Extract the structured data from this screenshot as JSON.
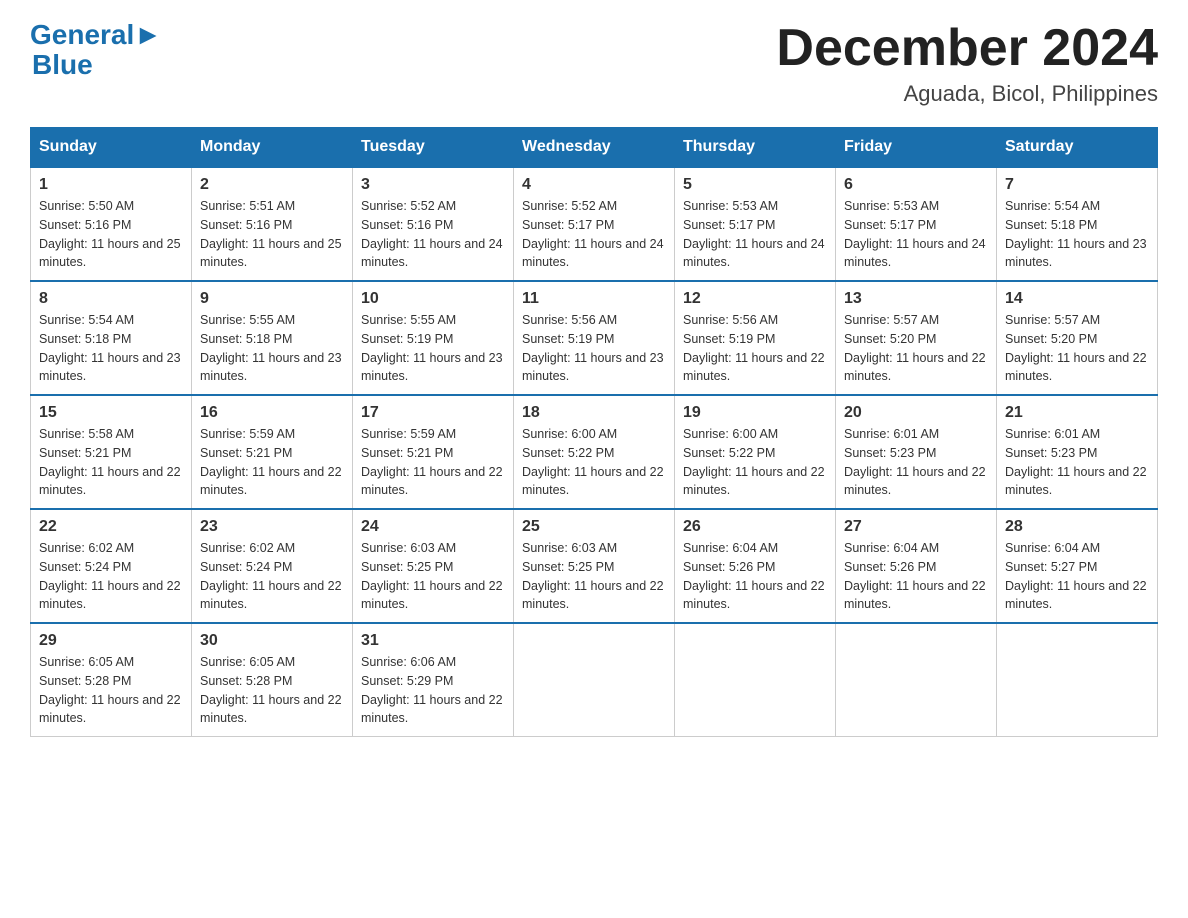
{
  "header": {
    "logo_general": "General",
    "logo_blue": "Blue",
    "month_title": "December 2024",
    "location": "Aguada, Bicol, Philippines"
  },
  "weekdays": [
    "Sunday",
    "Monday",
    "Tuesday",
    "Wednesday",
    "Thursday",
    "Friday",
    "Saturday"
  ],
  "weeks": [
    [
      {
        "day": "1",
        "sunrise": "5:50 AM",
        "sunset": "5:16 PM",
        "daylight": "11 hours and 25 minutes."
      },
      {
        "day": "2",
        "sunrise": "5:51 AM",
        "sunset": "5:16 PM",
        "daylight": "11 hours and 25 minutes."
      },
      {
        "day": "3",
        "sunrise": "5:52 AM",
        "sunset": "5:16 PM",
        "daylight": "11 hours and 24 minutes."
      },
      {
        "day": "4",
        "sunrise": "5:52 AM",
        "sunset": "5:17 PM",
        "daylight": "11 hours and 24 minutes."
      },
      {
        "day": "5",
        "sunrise": "5:53 AM",
        "sunset": "5:17 PM",
        "daylight": "11 hours and 24 minutes."
      },
      {
        "day": "6",
        "sunrise": "5:53 AM",
        "sunset": "5:17 PM",
        "daylight": "11 hours and 24 minutes."
      },
      {
        "day": "7",
        "sunrise": "5:54 AM",
        "sunset": "5:18 PM",
        "daylight": "11 hours and 23 minutes."
      }
    ],
    [
      {
        "day": "8",
        "sunrise": "5:54 AM",
        "sunset": "5:18 PM",
        "daylight": "11 hours and 23 minutes."
      },
      {
        "day": "9",
        "sunrise": "5:55 AM",
        "sunset": "5:18 PM",
        "daylight": "11 hours and 23 minutes."
      },
      {
        "day": "10",
        "sunrise": "5:55 AM",
        "sunset": "5:19 PM",
        "daylight": "11 hours and 23 minutes."
      },
      {
        "day": "11",
        "sunrise": "5:56 AM",
        "sunset": "5:19 PM",
        "daylight": "11 hours and 23 minutes."
      },
      {
        "day": "12",
        "sunrise": "5:56 AM",
        "sunset": "5:19 PM",
        "daylight": "11 hours and 22 minutes."
      },
      {
        "day": "13",
        "sunrise": "5:57 AM",
        "sunset": "5:20 PM",
        "daylight": "11 hours and 22 minutes."
      },
      {
        "day": "14",
        "sunrise": "5:57 AM",
        "sunset": "5:20 PM",
        "daylight": "11 hours and 22 minutes."
      }
    ],
    [
      {
        "day": "15",
        "sunrise": "5:58 AM",
        "sunset": "5:21 PM",
        "daylight": "11 hours and 22 minutes."
      },
      {
        "day": "16",
        "sunrise": "5:59 AM",
        "sunset": "5:21 PM",
        "daylight": "11 hours and 22 minutes."
      },
      {
        "day": "17",
        "sunrise": "5:59 AM",
        "sunset": "5:21 PM",
        "daylight": "11 hours and 22 minutes."
      },
      {
        "day": "18",
        "sunrise": "6:00 AM",
        "sunset": "5:22 PM",
        "daylight": "11 hours and 22 minutes."
      },
      {
        "day": "19",
        "sunrise": "6:00 AM",
        "sunset": "5:22 PM",
        "daylight": "11 hours and 22 minutes."
      },
      {
        "day": "20",
        "sunrise": "6:01 AM",
        "sunset": "5:23 PM",
        "daylight": "11 hours and 22 minutes."
      },
      {
        "day": "21",
        "sunrise": "6:01 AM",
        "sunset": "5:23 PM",
        "daylight": "11 hours and 22 minutes."
      }
    ],
    [
      {
        "day": "22",
        "sunrise": "6:02 AM",
        "sunset": "5:24 PM",
        "daylight": "11 hours and 22 minutes."
      },
      {
        "day": "23",
        "sunrise": "6:02 AM",
        "sunset": "5:24 PM",
        "daylight": "11 hours and 22 minutes."
      },
      {
        "day": "24",
        "sunrise": "6:03 AM",
        "sunset": "5:25 PM",
        "daylight": "11 hours and 22 minutes."
      },
      {
        "day": "25",
        "sunrise": "6:03 AM",
        "sunset": "5:25 PM",
        "daylight": "11 hours and 22 minutes."
      },
      {
        "day": "26",
        "sunrise": "6:04 AM",
        "sunset": "5:26 PM",
        "daylight": "11 hours and 22 minutes."
      },
      {
        "day": "27",
        "sunrise": "6:04 AM",
        "sunset": "5:26 PM",
        "daylight": "11 hours and 22 minutes."
      },
      {
        "day": "28",
        "sunrise": "6:04 AM",
        "sunset": "5:27 PM",
        "daylight": "11 hours and 22 minutes."
      }
    ],
    [
      {
        "day": "29",
        "sunrise": "6:05 AM",
        "sunset": "5:28 PM",
        "daylight": "11 hours and 22 minutes."
      },
      {
        "day": "30",
        "sunrise": "6:05 AM",
        "sunset": "5:28 PM",
        "daylight": "11 hours and 22 minutes."
      },
      {
        "day": "31",
        "sunrise": "6:06 AM",
        "sunset": "5:29 PM",
        "daylight": "11 hours and 22 minutes."
      },
      null,
      null,
      null,
      null
    ]
  ]
}
